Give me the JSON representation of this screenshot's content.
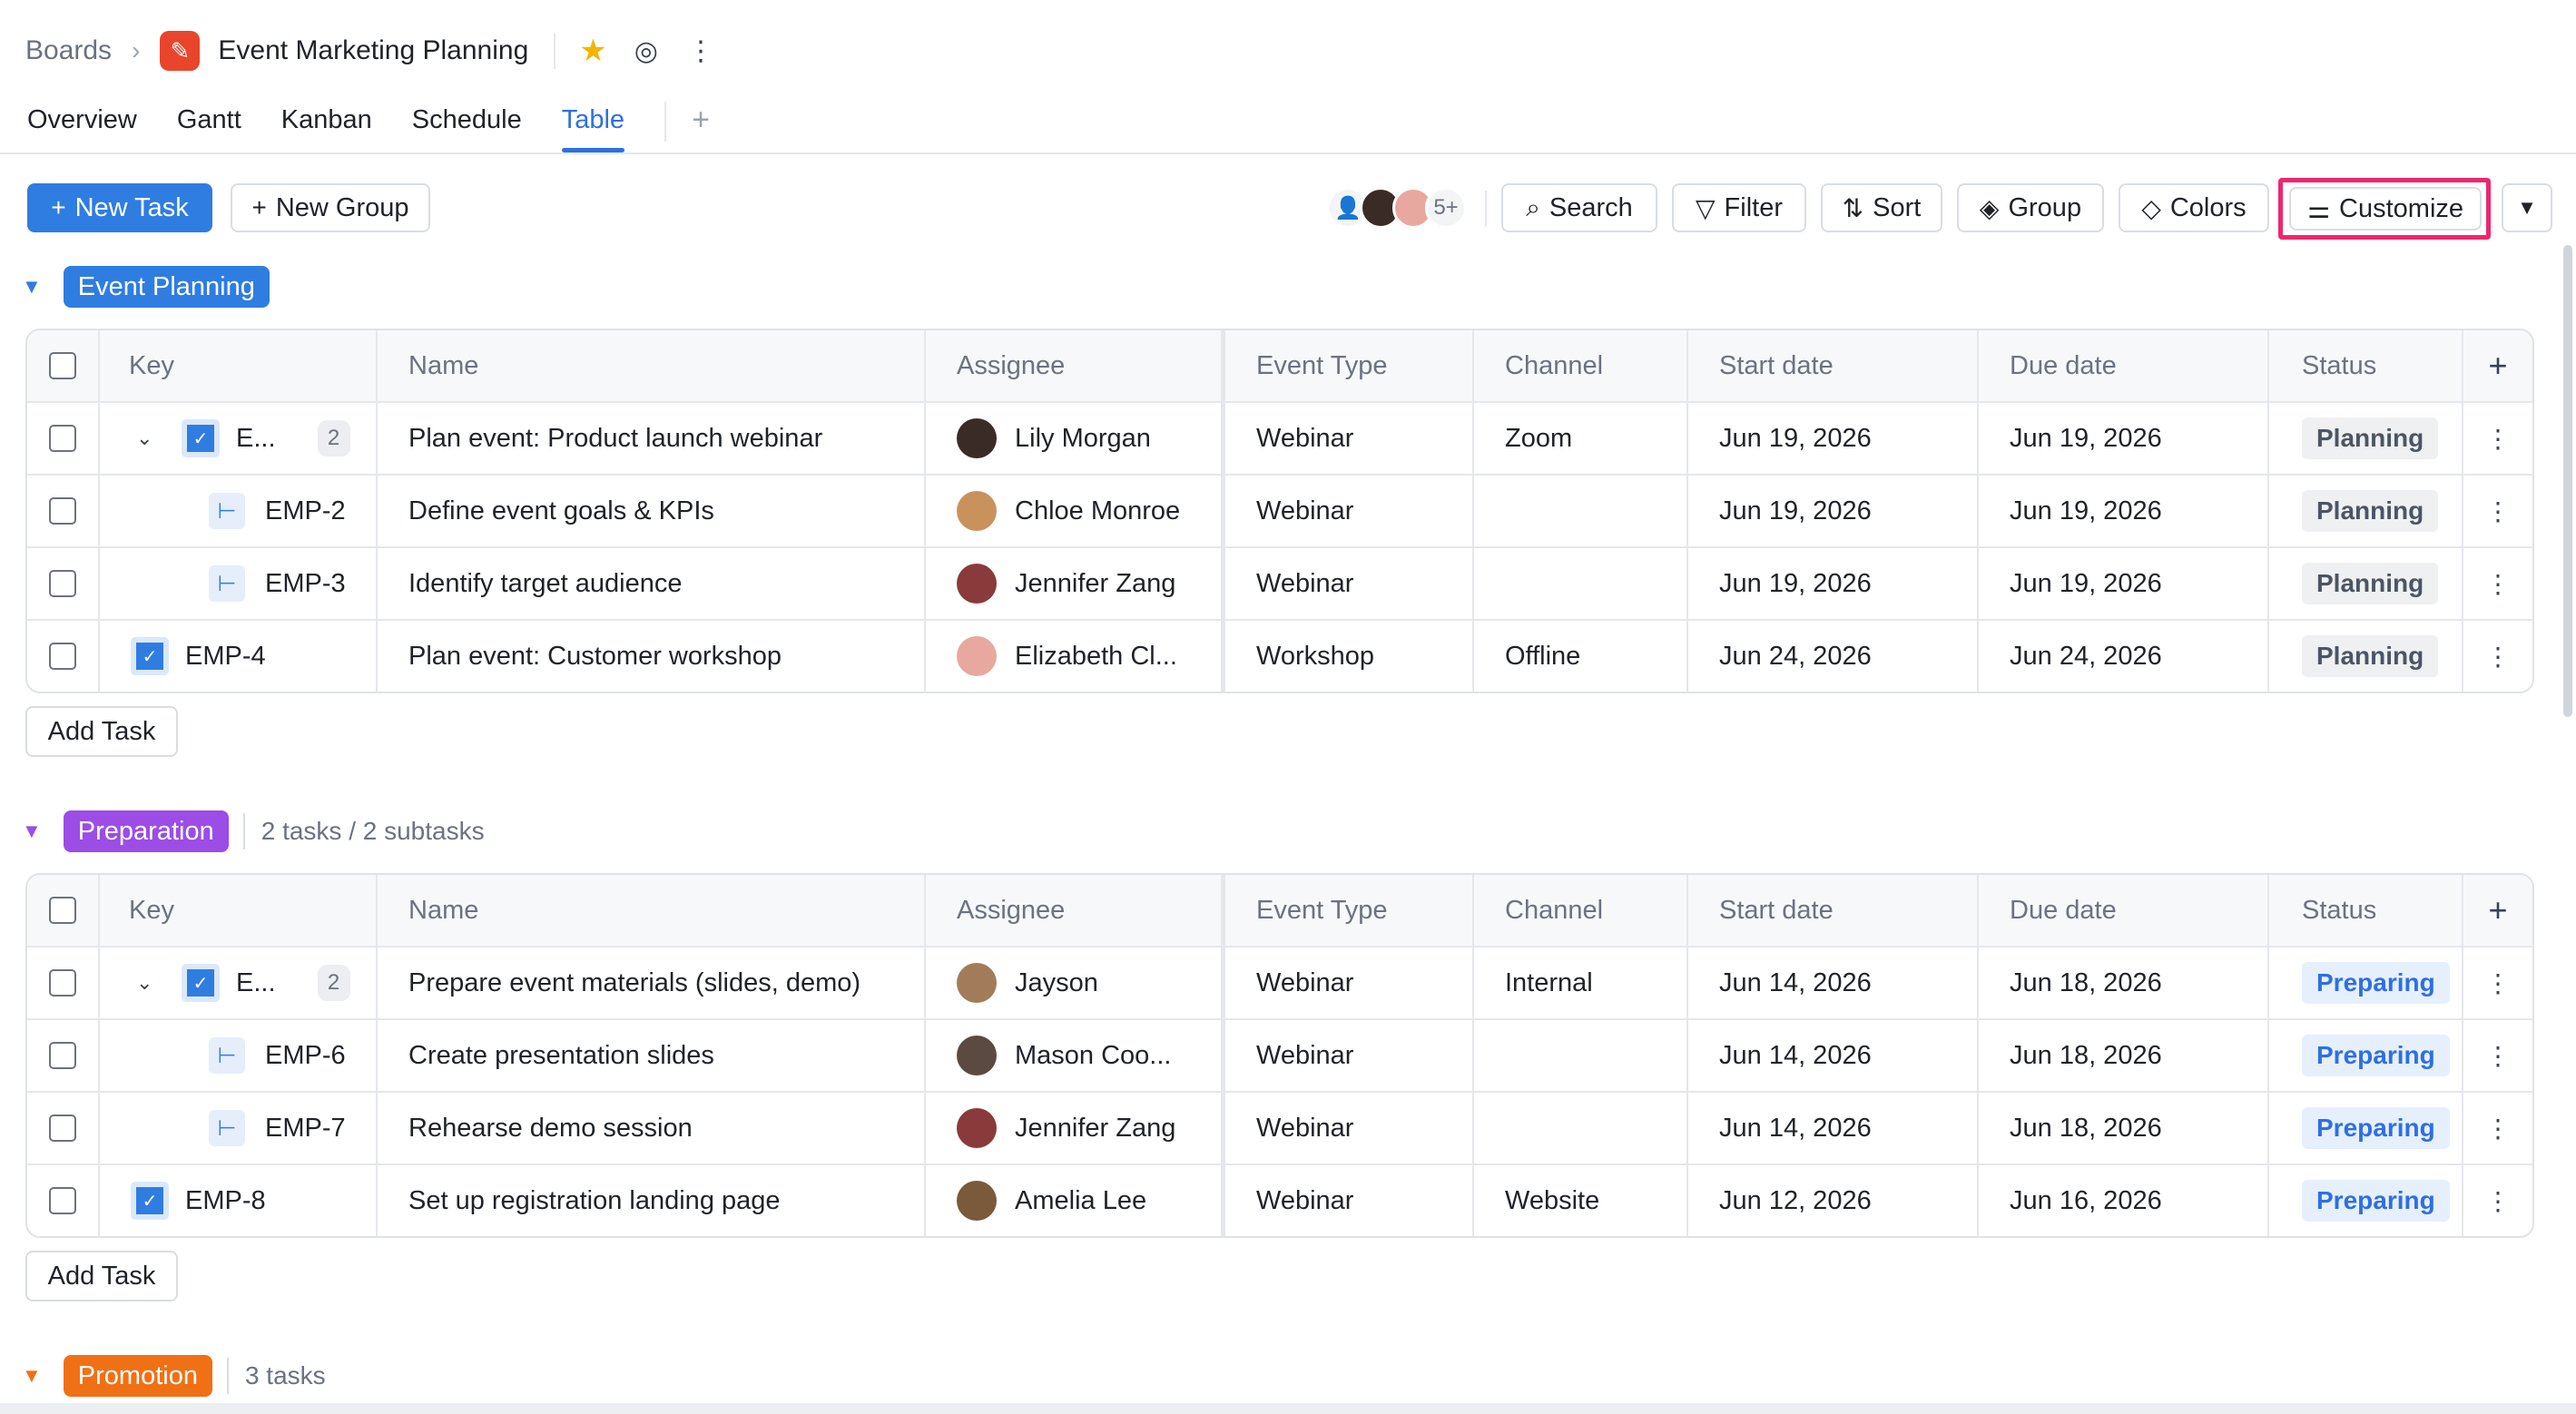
{
  "header": {
    "breadcrumb_root": "Boards",
    "board_title": "Event Marketing Planning"
  },
  "tabs": [
    {
      "label": "Overview"
    },
    {
      "label": "Gantt"
    },
    {
      "label": "Kanban"
    },
    {
      "label": "Schedule"
    },
    {
      "label": "Table"
    }
  ],
  "active_tab": "Table",
  "toolbar": {
    "new_task": "New Task",
    "new_group": "New Group",
    "avatars_more": "5+",
    "search": "Search",
    "filter": "Filter",
    "sort": "Sort",
    "group": "Group",
    "colors": "Colors",
    "customize": "Customize"
  },
  "columns": {
    "key": "Key",
    "name": "Name",
    "assignee": "Assignee",
    "event_type": "Event Type",
    "channel": "Channel",
    "start_date": "Start date",
    "due_date": "Due date",
    "status": "Status"
  },
  "add_task_label": "Add Task",
  "groups": [
    {
      "name": "Event Planning",
      "color": "#2f7de1",
      "meta": "",
      "rows": [
        {
          "kind": "parent",
          "key": "E...",
          "subcount": "2",
          "name": "Plan event: Product launch webinar",
          "assignee": "Lily Morgan",
          "avatar_color": "#3b2b26",
          "event_type": "Webinar",
          "channel": "Zoom",
          "start": "Jun 19, 2026",
          "due": "Jun 19, 2026",
          "status": "Planning"
        },
        {
          "kind": "sub",
          "key": "EMP-2",
          "name": "Define event goals & KPIs",
          "assignee": "Chloe Monroe",
          "avatar_color": "#c9925d",
          "event_type": "Webinar",
          "channel": "",
          "start": "Jun 19, 2026",
          "due": "Jun 19, 2026",
          "status": "Planning"
        },
        {
          "kind": "sub",
          "key": "EMP-3",
          "name": "Identify target audience",
          "assignee": "Jennifer Zang",
          "avatar_color": "#8a3a3a",
          "event_type": "Webinar",
          "channel": "",
          "start": "Jun 19, 2026",
          "due": "Jun 19, 2026",
          "status": "Planning"
        },
        {
          "kind": "task",
          "key": "EMP-4",
          "name": "Plan event: Customer workshop",
          "assignee": "Elizabeth Cl...",
          "avatar_color": "#e8a8a0",
          "event_type": "Workshop",
          "channel": "Offline",
          "start": "Jun 24, 2026",
          "due": "Jun 24, 2026",
          "status": "Planning"
        }
      ]
    },
    {
      "name": "Preparation",
      "color": "#9b4de6",
      "meta": "2 tasks / 2 subtasks",
      "rows": [
        {
          "kind": "parent",
          "key": "E...",
          "subcount": "2",
          "name": "Prepare event materials (slides, demo)",
          "assignee": "Jayson",
          "avatar_color": "#a27c5a",
          "event_type": "Webinar",
          "channel": "Internal",
          "start": "Jun 14, 2026",
          "due": "Jun 18, 2026",
          "status": "Preparing"
        },
        {
          "kind": "sub",
          "key": "EMP-6",
          "name": "Create presentation slides",
          "assignee": "Mason Coo...",
          "avatar_color": "#5b4a42",
          "event_type": "Webinar",
          "channel": "",
          "start": "Jun 14, 2026",
          "due": "Jun 18, 2026",
          "status": "Preparing"
        },
        {
          "kind": "sub",
          "key": "EMP-7",
          "name": "Rehearse demo session",
          "assignee": "Jennifer Zang",
          "avatar_color": "#8a3a3a",
          "event_type": "Webinar",
          "channel": "",
          "start": "Jun 14, 2026",
          "due": "Jun 18, 2026",
          "status": "Preparing"
        },
        {
          "kind": "task",
          "key": "EMP-8",
          "name": "Set up registration landing page",
          "assignee": "Amelia Lee",
          "avatar_color": "#7a5a3a",
          "event_type": "Webinar",
          "channel": "Website",
          "start": "Jun 12, 2026",
          "due": "Jun 16, 2026",
          "status": "Preparing"
        }
      ]
    },
    {
      "name": "Promotion",
      "color": "#f07015",
      "meta": "3 tasks",
      "rows": []
    }
  ]
}
